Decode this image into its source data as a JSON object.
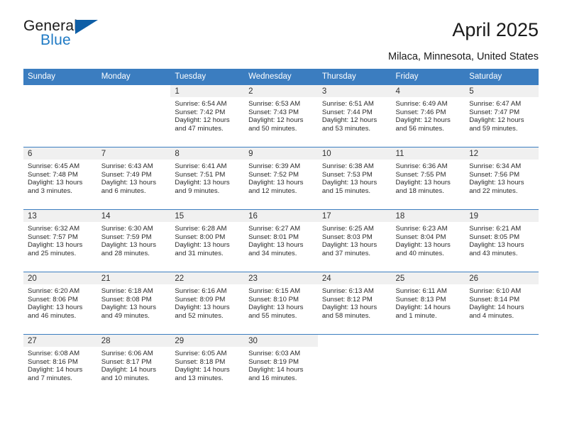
{
  "brand": {
    "word_one": "General",
    "word_two": "Blue",
    "triangle_icon": "triangle-icon",
    "accent_blue": "#1f7ac4",
    "dark_blue": "#0e5ea6"
  },
  "header": {
    "title": "April 2025",
    "location": "Milaca, Minnesota, United States"
  },
  "colors": {
    "header_bg": "#3b7dc0",
    "daynum_bg": "#f0f0f0",
    "cell_bg": "#ffffff",
    "text": "#2b2b2b"
  },
  "weekday_headers": [
    "Sunday",
    "Monday",
    "Tuesday",
    "Wednesday",
    "Thursday",
    "Friday",
    "Saturday"
  ],
  "weeks": [
    [
      {
        "day": "",
        "sunrise": "",
        "sunset": "",
        "daylight": "",
        "daylight_cont": ""
      },
      {
        "day": "",
        "sunrise": "",
        "sunset": "",
        "daylight": "",
        "daylight_cont": ""
      },
      {
        "day": "1",
        "sunrise": "Sunrise: 6:54 AM",
        "sunset": "Sunset: 7:42 PM",
        "daylight": "Daylight: 12 hours",
        "daylight_cont": "and 47 minutes."
      },
      {
        "day": "2",
        "sunrise": "Sunrise: 6:53 AM",
        "sunset": "Sunset: 7:43 PM",
        "daylight": "Daylight: 12 hours",
        "daylight_cont": "and 50 minutes."
      },
      {
        "day": "3",
        "sunrise": "Sunrise: 6:51 AM",
        "sunset": "Sunset: 7:44 PM",
        "daylight": "Daylight: 12 hours",
        "daylight_cont": "and 53 minutes."
      },
      {
        "day": "4",
        "sunrise": "Sunrise: 6:49 AM",
        "sunset": "Sunset: 7:46 PM",
        "daylight": "Daylight: 12 hours",
        "daylight_cont": "and 56 minutes."
      },
      {
        "day": "5",
        "sunrise": "Sunrise: 6:47 AM",
        "sunset": "Sunset: 7:47 PM",
        "daylight": "Daylight: 12 hours",
        "daylight_cont": "and 59 minutes."
      }
    ],
    [
      {
        "day": "6",
        "sunrise": "Sunrise: 6:45 AM",
        "sunset": "Sunset: 7:48 PM",
        "daylight": "Daylight: 13 hours",
        "daylight_cont": "and 3 minutes."
      },
      {
        "day": "7",
        "sunrise": "Sunrise: 6:43 AM",
        "sunset": "Sunset: 7:49 PM",
        "daylight": "Daylight: 13 hours",
        "daylight_cont": "and 6 minutes."
      },
      {
        "day": "8",
        "sunrise": "Sunrise: 6:41 AM",
        "sunset": "Sunset: 7:51 PM",
        "daylight": "Daylight: 13 hours",
        "daylight_cont": "and 9 minutes."
      },
      {
        "day": "9",
        "sunrise": "Sunrise: 6:39 AM",
        "sunset": "Sunset: 7:52 PM",
        "daylight": "Daylight: 13 hours",
        "daylight_cont": "and 12 minutes."
      },
      {
        "day": "10",
        "sunrise": "Sunrise: 6:38 AM",
        "sunset": "Sunset: 7:53 PM",
        "daylight": "Daylight: 13 hours",
        "daylight_cont": "and 15 minutes."
      },
      {
        "day": "11",
        "sunrise": "Sunrise: 6:36 AM",
        "sunset": "Sunset: 7:55 PM",
        "daylight": "Daylight: 13 hours",
        "daylight_cont": "and 18 minutes."
      },
      {
        "day": "12",
        "sunrise": "Sunrise: 6:34 AM",
        "sunset": "Sunset: 7:56 PM",
        "daylight": "Daylight: 13 hours",
        "daylight_cont": "and 22 minutes."
      }
    ],
    [
      {
        "day": "13",
        "sunrise": "Sunrise: 6:32 AM",
        "sunset": "Sunset: 7:57 PM",
        "daylight": "Daylight: 13 hours",
        "daylight_cont": "and 25 minutes."
      },
      {
        "day": "14",
        "sunrise": "Sunrise: 6:30 AM",
        "sunset": "Sunset: 7:59 PM",
        "daylight": "Daylight: 13 hours",
        "daylight_cont": "and 28 minutes."
      },
      {
        "day": "15",
        "sunrise": "Sunrise: 6:28 AM",
        "sunset": "Sunset: 8:00 PM",
        "daylight": "Daylight: 13 hours",
        "daylight_cont": "and 31 minutes."
      },
      {
        "day": "16",
        "sunrise": "Sunrise: 6:27 AM",
        "sunset": "Sunset: 8:01 PM",
        "daylight": "Daylight: 13 hours",
        "daylight_cont": "and 34 minutes."
      },
      {
        "day": "17",
        "sunrise": "Sunrise: 6:25 AM",
        "sunset": "Sunset: 8:03 PM",
        "daylight": "Daylight: 13 hours",
        "daylight_cont": "and 37 minutes."
      },
      {
        "day": "18",
        "sunrise": "Sunrise: 6:23 AM",
        "sunset": "Sunset: 8:04 PM",
        "daylight": "Daylight: 13 hours",
        "daylight_cont": "and 40 minutes."
      },
      {
        "day": "19",
        "sunrise": "Sunrise: 6:21 AM",
        "sunset": "Sunset: 8:05 PM",
        "daylight": "Daylight: 13 hours",
        "daylight_cont": "and 43 minutes."
      }
    ],
    [
      {
        "day": "20",
        "sunrise": "Sunrise: 6:20 AM",
        "sunset": "Sunset: 8:06 PM",
        "daylight": "Daylight: 13 hours",
        "daylight_cont": "and 46 minutes."
      },
      {
        "day": "21",
        "sunrise": "Sunrise: 6:18 AM",
        "sunset": "Sunset: 8:08 PM",
        "daylight": "Daylight: 13 hours",
        "daylight_cont": "and 49 minutes."
      },
      {
        "day": "22",
        "sunrise": "Sunrise: 6:16 AM",
        "sunset": "Sunset: 8:09 PM",
        "daylight": "Daylight: 13 hours",
        "daylight_cont": "and 52 minutes."
      },
      {
        "day": "23",
        "sunrise": "Sunrise: 6:15 AM",
        "sunset": "Sunset: 8:10 PM",
        "daylight": "Daylight: 13 hours",
        "daylight_cont": "and 55 minutes."
      },
      {
        "day": "24",
        "sunrise": "Sunrise: 6:13 AM",
        "sunset": "Sunset: 8:12 PM",
        "daylight": "Daylight: 13 hours",
        "daylight_cont": "and 58 minutes."
      },
      {
        "day": "25",
        "sunrise": "Sunrise: 6:11 AM",
        "sunset": "Sunset: 8:13 PM",
        "daylight": "Daylight: 14 hours",
        "daylight_cont": "and 1 minute."
      },
      {
        "day": "26",
        "sunrise": "Sunrise: 6:10 AM",
        "sunset": "Sunset: 8:14 PM",
        "daylight": "Daylight: 14 hours",
        "daylight_cont": "and 4 minutes."
      }
    ],
    [
      {
        "day": "27",
        "sunrise": "Sunrise: 6:08 AM",
        "sunset": "Sunset: 8:16 PM",
        "daylight": "Daylight: 14 hours",
        "daylight_cont": "and 7 minutes."
      },
      {
        "day": "28",
        "sunrise": "Sunrise: 6:06 AM",
        "sunset": "Sunset: 8:17 PM",
        "daylight": "Daylight: 14 hours",
        "daylight_cont": "and 10 minutes."
      },
      {
        "day": "29",
        "sunrise": "Sunrise: 6:05 AM",
        "sunset": "Sunset: 8:18 PM",
        "daylight": "Daylight: 14 hours",
        "daylight_cont": "and 13 minutes."
      },
      {
        "day": "30",
        "sunrise": "Sunrise: 6:03 AM",
        "sunset": "Sunset: 8:19 PM",
        "daylight": "Daylight: 14 hours",
        "daylight_cont": "and 16 minutes."
      },
      {
        "day": "",
        "sunrise": "",
        "sunset": "",
        "daylight": "",
        "daylight_cont": ""
      },
      {
        "day": "",
        "sunrise": "",
        "sunset": "",
        "daylight": "",
        "daylight_cont": ""
      },
      {
        "day": "",
        "sunrise": "",
        "sunset": "",
        "daylight": "",
        "daylight_cont": ""
      }
    ]
  ]
}
